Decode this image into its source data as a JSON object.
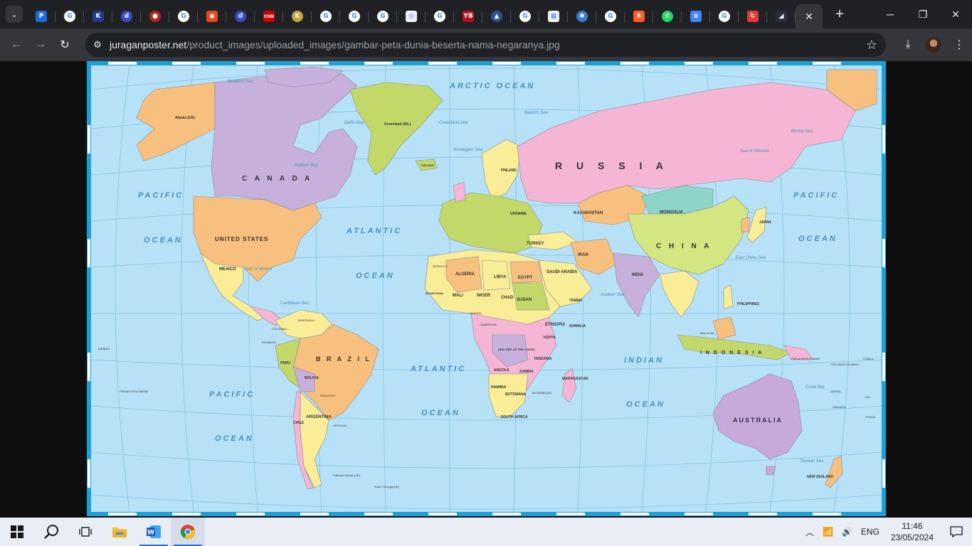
{
  "browser": {
    "tabs": [
      {
        "icon": "tab-search-icon"
      },
      {
        "label": "P",
        "color": "#1d6cd6",
        "shape": "sq"
      },
      {
        "label": "G",
        "color": "#ffffff",
        "shape": "round"
      },
      {
        "label": "K",
        "color": "#1f3c88",
        "shape": "sq"
      },
      {
        "label": "d",
        "color": "#3a4cc7",
        "shape": "round"
      },
      {
        "label": "●",
        "color": "#b3261e",
        "shape": "round"
      },
      {
        "label": "G",
        "color": "#ffffff",
        "shape": "round"
      },
      {
        "label": "◉",
        "color": "#e04a1f",
        "shape": "sq"
      },
      {
        "label": "d",
        "color": "#3a4cc7",
        "shape": "round"
      },
      {
        "label": "CNN",
        "color": "#cc0000",
        "shape": "sq"
      },
      {
        "label": "K",
        "color": "#c8a23a",
        "shape": "round"
      },
      {
        "label": "G",
        "color": "#ffffff",
        "shape": "round"
      },
      {
        "label": "G",
        "color": "#ffffff",
        "shape": "round"
      },
      {
        "label": "G",
        "color": "#ffffff",
        "shape": "round"
      },
      {
        "label": "◎",
        "color": "#f1f1f1",
        "shape": "sq"
      },
      {
        "label": "G",
        "color": "#ffffff",
        "shape": "round"
      },
      {
        "label": "YB",
        "color": "#b0111a",
        "shape": "sq"
      },
      {
        "label": "▲",
        "color": "#2d4f9e",
        "shape": "round"
      },
      {
        "label": "G",
        "color": "#ffffff",
        "shape": "round"
      },
      {
        "label": "▦",
        "color": "#f3f3f3",
        "shape": "sq"
      },
      {
        "label": "✱",
        "color": "#3a7bd5",
        "shape": "round"
      },
      {
        "label": "G",
        "color": "#ffffff",
        "shape": "round"
      },
      {
        "label": "6",
        "color": "#ff5a1f",
        "shape": "sq"
      },
      {
        "label": "✆",
        "color": "#25d366",
        "shape": "round"
      },
      {
        "label": "≡",
        "color": "#4285f4",
        "shape": "sq"
      },
      {
        "label": "G",
        "color": "#ffffff",
        "shape": "round"
      },
      {
        "label": "↻",
        "color": "#e53935",
        "shape": "sq"
      },
      {
        "label": "◢",
        "color": "#2a2d3e",
        "shape": "sq"
      }
    ],
    "close_tab": "✕",
    "new_tab": "+",
    "url_host": "juraganposter.net",
    "url_path": "/product_images/uploaded_images/gambar-peta-dunia-beserta-nama-negaranya.jpg"
  },
  "map": {
    "countries": {
      "russia": "R U S S I A",
      "canada": "C A N A D A",
      "usa": "UNITED STATES",
      "china": "C H I N A",
      "brazil": "B R A Z I L",
      "australia": "AUSTRALIA",
      "mongolia": "MONGOLIA",
      "kazakhstan": "KAZAKHSTAN",
      "india": "INDIA",
      "indonesia": "I N D O N E S I A",
      "algeria": "ALGERIA",
      "libya": "LIBYA",
      "egypt": "EGYPT",
      "sudan": "SUDAN",
      "chad": "CHAD",
      "niger": "NIGER",
      "mali": "MALI",
      "ethiopia": "ETHIOPIA",
      "saudi": "SAUDI ARABIA",
      "iran": "IRAN",
      "turkey": "TURKEY",
      "mexico": "MEXICO",
      "argentina": "ARGENTINA",
      "peru": "PERU",
      "bolivia": "BOLIVIA",
      "chile": "CHILE",
      "angola": "ANGOLA",
      "namibia": "NAMIBIA",
      "south_africa": "SOUTH AFRICA",
      "madagascar": "MADAGASCAR",
      "greenland": "Greenland (Dk.)",
      "alaska": "Alaska (US)",
      "japan": "JAPAN",
      "philippines": "PHILIPPINES",
      "new_zealand": "NEW ZEALAND",
      "tanzania": "TANZANIA",
      "dr_congo": "DEM. REP. OF THE CONGO",
      "zambia": "ZAMBIA",
      "botswana": "BOTSWANA",
      "iceland": "ICELAND",
      "mauritania": "MAURITANIA",
      "kenya": "KENYA",
      "somalia": "SOMALIA",
      "yemen": "YEMEN",
      "ukraine": "UKRAINE",
      "finland": "FINLAND"
    },
    "oceans": {
      "arctic": "ARCTIC OCEAN",
      "pacific_w": "PACIFIC",
      "pacific_w2": "OCEAN",
      "pacific_e": "PACIFIC",
      "pacific_e2": "OCEAN",
      "atlantic_n": "ATLANTIC",
      "atlantic_n2": "OCEAN",
      "atlantic_s": "ATLANTIC",
      "atlantic_s2": "OCEAN",
      "pacific_s": "PACIFIC",
      "pacific_s2": "OCEAN",
      "indian": "INDIAN",
      "indian2": "OCEAN"
    },
    "seas": {
      "beaufort": "Beaufort Sea",
      "bering": "Bering Sea",
      "barents": "Barents Sea",
      "norwegian": "Norwegian Sea",
      "greenland_sea": "Greenland Sea",
      "baffin": "Baffin Bay",
      "okhotsk": "Sea of Okhotsk",
      "arabian": "Arabian Sea",
      "coral": "Coral Sea",
      "tasman": "Tasman Sea",
      "caribbean": "Caribbean Sea",
      "mexico_gulf": "Gulf of Mexico",
      "east_china": "East China Sea",
      "hudson": "Hudson Bay"
    },
    "small": {
      "french_polynesia": "FRENCH POLYNESIA",
      "kiribati": "KIRIBATI",
      "fiji": "FIJI",
      "tonga": "TONGA",
      "samoa": "SAMOA",
      "tuvalu": "TUVALU",
      "vanuatu": "VANUATU",
      "solomon": "SOLOMON ISLANDS",
      "png": "PAPUA NEW GUINEA",
      "falklands": "Falkland Islands (UK)",
      "south_georgia": "South Georgia (UK)",
      "ecuador": "ECUADOR",
      "colombia": "COLOMBIA",
      "venezuela": "VENEZUELA",
      "uruguay": "URUGUAY",
      "paraguay": "PARAGUAY",
      "malaysia": "MALAYSIA",
      "mozambique": "MOZAMBIQUE",
      "cameroon": "CAMEROON",
      "nigeria": "NIGERIA",
      "morocco": "MOROCCO"
    }
  },
  "taskbar": {
    "lang": "ENG",
    "time": "11:46",
    "date": "23/05/2024"
  },
  "colors": {
    "ocean": "#b7e1f7",
    "frame": "#1ba1d8",
    "russia": "#f5b6d6",
    "canada": "#c7b0dc",
    "usa": "#f8c07e",
    "greenland": "#c2d96a",
    "china": "#d4e682",
    "brazil": "#f8c07e",
    "australia": "#c7a9dc",
    "africa_yellow": "#f9ed98",
    "label": "#333333",
    "ocean_label": "#4a8fb8"
  }
}
